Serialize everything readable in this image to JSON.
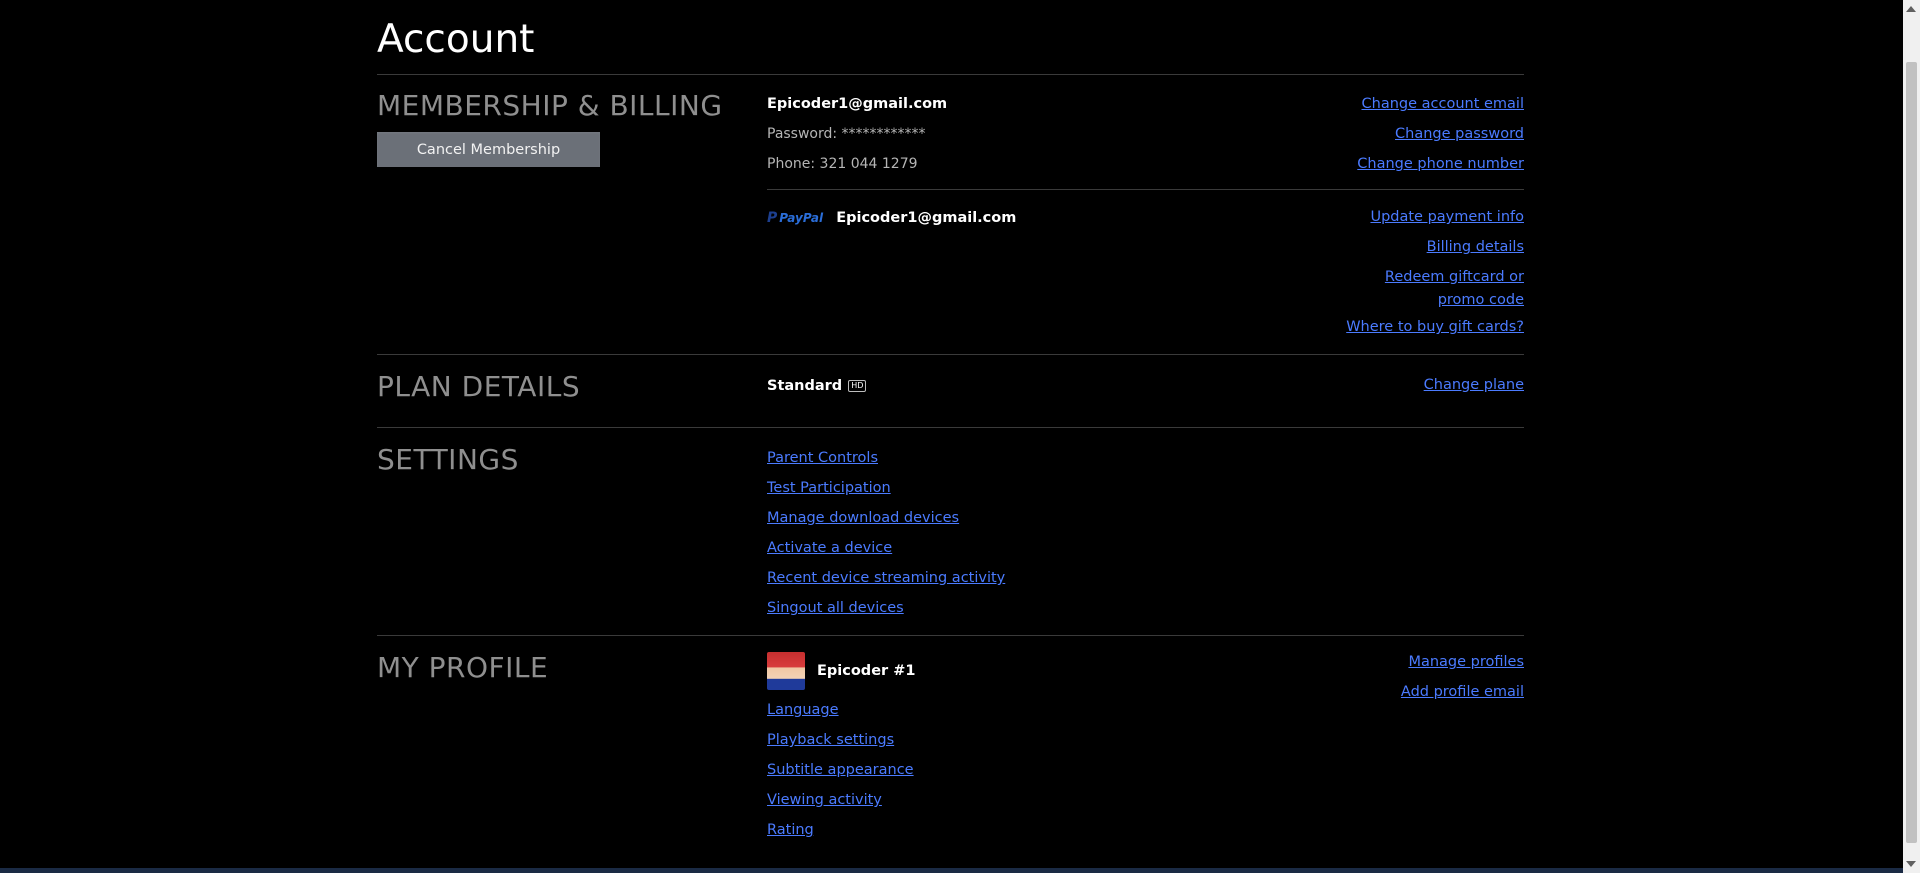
{
  "page": {
    "title": "Account"
  },
  "membership": {
    "heading": "MEMBERSHIP & BILLING",
    "cancel_label": "Cancel Membership",
    "email": "Epicoder1@gmail.com",
    "password": "Password: ************",
    "phone": "Phone: 321 044 1279",
    "links": {
      "change_email": "Change account email",
      "change_password": "Change password",
      "change_phone": "Change phone number"
    },
    "payment": {
      "paypal_logo": "PayPal",
      "paypal_email": "Epicoder1@gmail.com",
      "links": {
        "update_payment": "Update payment info",
        "billing_details": "Billing details",
        "redeem": "Redeem giftcard or promo code",
        "where_buy": "Where to buy gift cards?"
      }
    }
  },
  "plan": {
    "heading": "PLAN DETAILS",
    "name": "Standard",
    "badge": "HD",
    "change_link": "Change plane"
  },
  "settings": {
    "heading": "SETTINGS",
    "links": [
      "Parent Controls",
      "Test Participation",
      "Manage download devices",
      "Activate a device",
      "Recent device streaming activity",
      "Singout all devices"
    ]
  },
  "profile": {
    "heading": "MY PROFILE",
    "name": "Epicoder #1",
    "right_links": [
      "Manage profiles",
      "Add profile email"
    ],
    "links": [
      "Language",
      "Playback settings",
      "Subtitle appearance",
      "Viewing activity",
      "Rating"
    ]
  },
  "colors": {
    "link": "#4b7bff",
    "background": "#000000",
    "button": "#6b7078"
  }
}
